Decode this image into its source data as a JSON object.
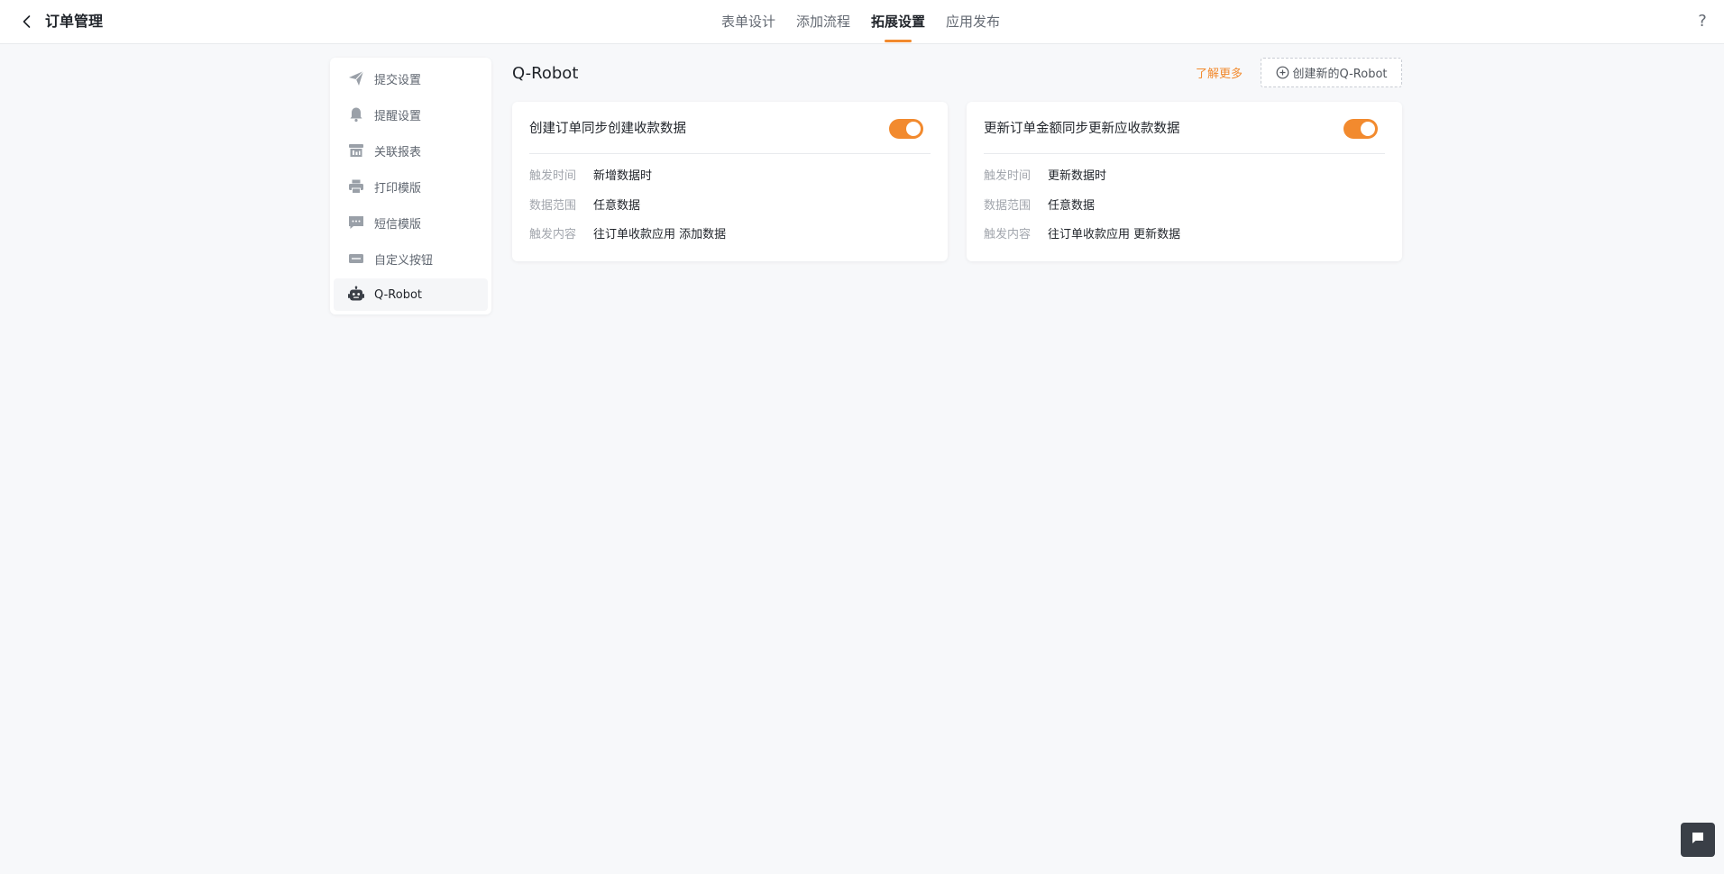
{
  "header": {
    "title": "订单管理",
    "tabs": [
      {
        "label": "表单设计",
        "active": false
      },
      {
        "label": "添加流程",
        "active": false
      },
      {
        "label": "拓展设置",
        "active": true
      },
      {
        "label": "应用发布",
        "active": false
      }
    ],
    "help": "?"
  },
  "sidebar": {
    "items": [
      {
        "label": "提交设置",
        "icon": "paper-plane-icon",
        "active": false
      },
      {
        "label": "提醒设置",
        "icon": "bell-icon",
        "active": false
      },
      {
        "label": "关联报表",
        "icon": "report-icon",
        "active": false
      },
      {
        "label": "打印模版",
        "icon": "printer-icon",
        "active": false
      },
      {
        "label": "短信模版",
        "icon": "message-icon",
        "active": false
      },
      {
        "label": "自定义按钮",
        "icon": "button-icon",
        "active": false
      },
      {
        "label": "Q-Robot",
        "icon": "robot-icon",
        "active": true
      }
    ]
  },
  "main": {
    "title": "Q-Robot",
    "learn_more": "了解更多",
    "create_button": "创建新的Q-Robot",
    "cards": [
      {
        "title": "创建订单同步创建收款数据",
        "enabled": true,
        "rows": [
          {
            "label": "触发时间",
            "value": "新增数据时"
          },
          {
            "label": "数据范围",
            "value": "任意数据"
          },
          {
            "label": "触发内容",
            "value": "往订单收款应用 添加数据"
          }
        ]
      },
      {
        "title": "更新订单金额同步更新应收款数据",
        "enabled": true,
        "rows": [
          {
            "label": "触发时间",
            "value": "更新数据时"
          },
          {
            "label": "数据范围",
            "value": "任意数据"
          },
          {
            "label": "触发内容",
            "value": "往订单收款应用 更新数据"
          }
        ]
      }
    ]
  },
  "colors": {
    "accent": "#f28a2e",
    "text_primary": "#1f2329",
    "text_muted": "#a2a6ad",
    "background": "#f7f8fa"
  }
}
